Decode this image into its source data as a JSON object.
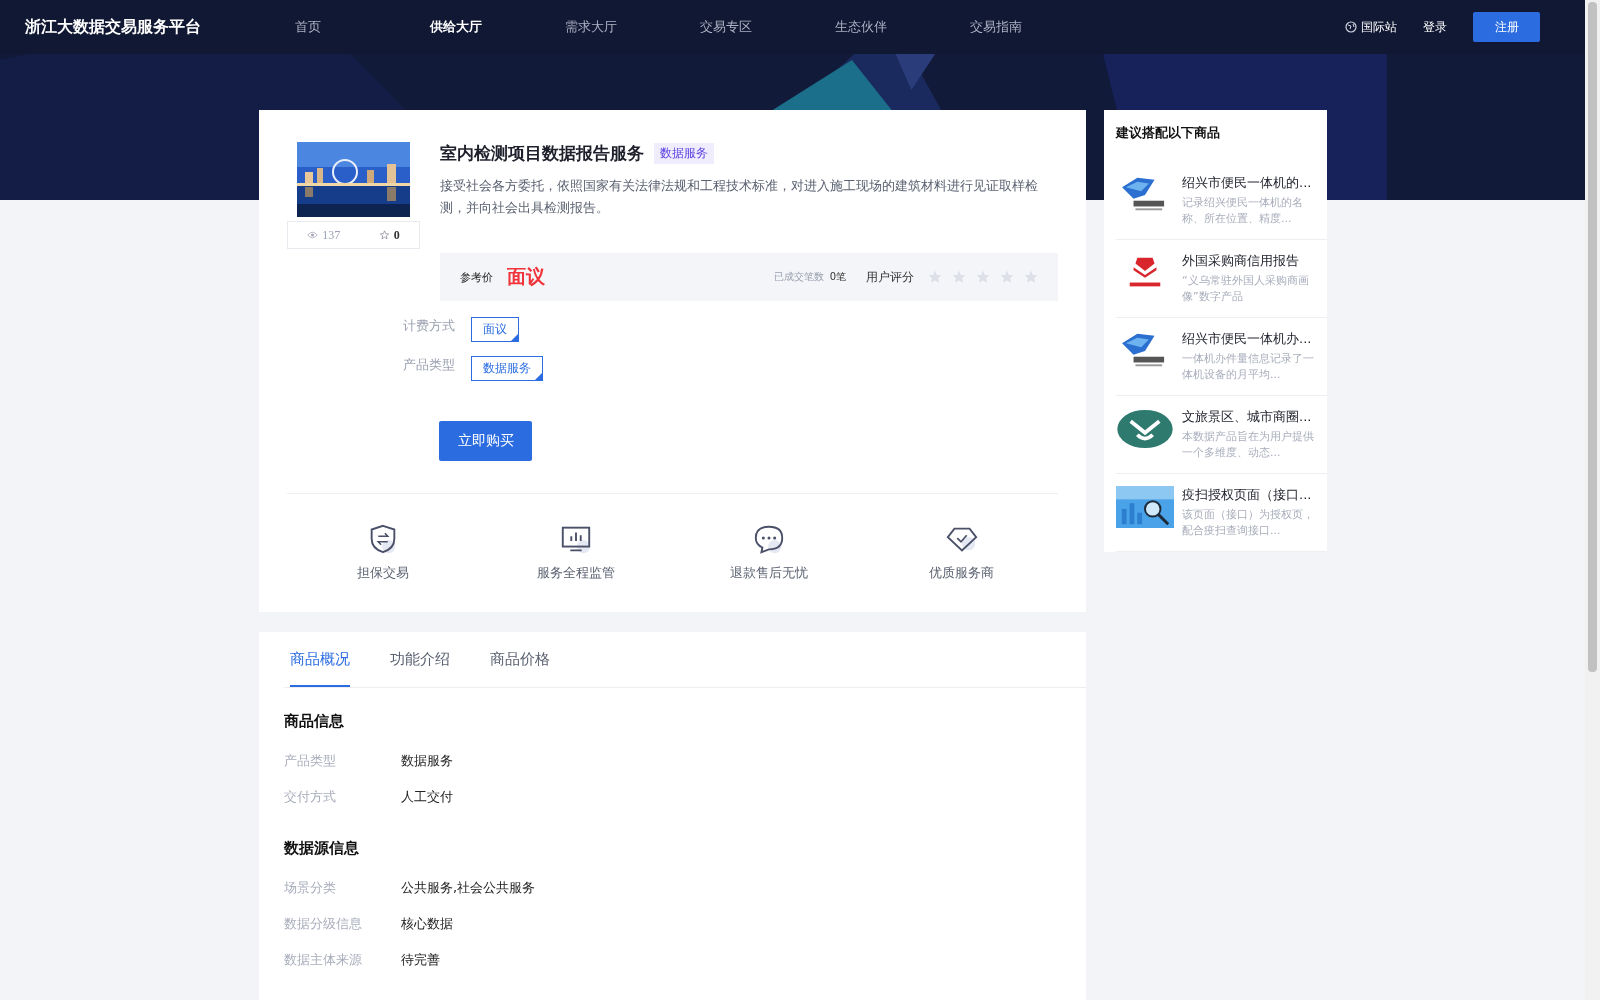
{
  "header": {
    "logo": "浙江大数据交易服务平台",
    "nav": [
      {
        "label": "首页",
        "selected": false
      },
      {
        "label": "供给大厅",
        "selected": true
      },
      {
        "label": "需求大厅",
        "selected": false
      },
      {
        "label": "交易专区",
        "selected": false
      },
      {
        "label": "生态伙伴",
        "selected": false
      },
      {
        "label": "交易指南",
        "selected": false
      }
    ],
    "language": "国际站",
    "login": "登录",
    "register": "注册"
  },
  "product": {
    "title": "室内检测项目数据报告服务",
    "tag": "数据服务",
    "description": "接受社会各方委托，依照国家有关法律法规和工程技术标准，对进入施工现场的建筑材料进行见证取样检测，并向社会出具检测报告。",
    "views": "137",
    "favorites": "0",
    "price_label": "参考价",
    "price": "面议",
    "deals_label": "已成交笔数",
    "deals": "0笔",
    "rating_label": "用户评分",
    "stars": 0,
    "options": [
      {
        "label": "计费方式",
        "value": "面议"
      },
      {
        "label": "产品类型",
        "value": "数据服务"
      }
    ],
    "buy_button": "立即购买"
  },
  "guarantees": [
    {
      "kind": "shield",
      "label": "担保交易"
    },
    {
      "kind": "monitor",
      "label": "服务全程监管"
    },
    {
      "kind": "chat",
      "label": "退款售后无忧"
    },
    {
      "kind": "diamond",
      "label": "优质服务商"
    }
  ],
  "tabs": [
    {
      "label": "商品概况",
      "selected": true
    },
    {
      "label": "功能介绍",
      "selected": false
    },
    {
      "label": "商品价格",
      "selected": false
    }
  ],
  "sections": [
    {
      "title": "商品信息",
      "rows": [
        {
          "label": "产品类型",
          "value": "数据服务"
        },
        {
          "label": "交付方式",
          "value": "人工交付"
        }
      ]
    },
    {
      "title": "数据源信息",
      "rows": [
        {
          "label": "场景分类",
          "value": "公共服务,社会公共服务"
        },
        {
          "label": "数据分级信息",
          "value": "核心数据"
        },
        {
          "label": "数据主体来源",
          "value": "待完善"
        }
      ]
    }
  ],
  "recommendations": {
    "title": "建议搭配以下商品",
    "items": [
      {
        "kind": "blue-logo",
        "title": "绍兴市便民一体机的...",
        "description": "记录绍兴便民一体机的名称、所在位置、精度..."
      },
      {
        "kind": "red-logo",
        "title": "外国采购商信用报告",
        "description": "“义乌常驻外国人采购商画像”数字产品"
      },
      {
        "kind": "blue-logo",
        "title": "绍兴市便民一体机办...",
        "description": "一体机办件量信息记录了一体机设备的月平均..."
      },
      {
        "kind": "green-logo",
        "title": "文旅景区、城市商圈...",
        "description": "本数据产品旨在为用户提供一个多维度、动态..."
      },
      {
        "kind": "picture",
        "title": "疫扫授权页面（接口...",
        "description": "该页面（接口）为授权页，配合疫扫查询接口..."
      }
    ]
  }
}
